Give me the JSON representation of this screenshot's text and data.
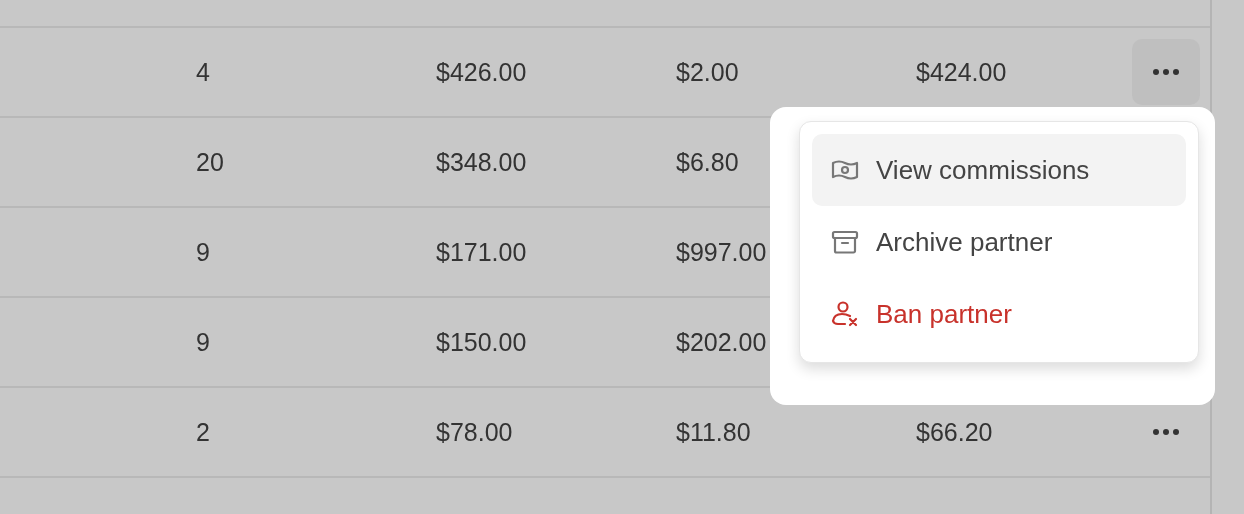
{
  "table": {
    "rows": [
      {
        "cells": [
          "4",
          "$426.00",
          "$2.00",
          "$424.00"
        ],
        "menu_open": true
      },
      {
        "cells": [
          "20",
          "$348.00",
          "$6.80"
        ]
      },
      {
        "cells": [
          "9",
          "$171.00",
          "$997.00"
        ]
      },
      {
        "cells": [
          "9",
          "$150.00",
          "$202.00"
        ]
      },
      {
        "cells": [
          "2",
          "$78.00",
          "$11.80",
          "$66.20"
        ],
        "menu_open": false
      },
      {
        "cells": []
      }
    ]
  },
  "menu": {
    "items": [
      {
        "label": "View commissions",
        "kind": "default",
        "selected": true
      },
      {
        "label": "Archive partner",
        "kind": "default",
        "selected": false
      },
      {
        "label": "Ban partner",
        "kind": "danger",
        "selected": false
      }
    ]
  }
}
